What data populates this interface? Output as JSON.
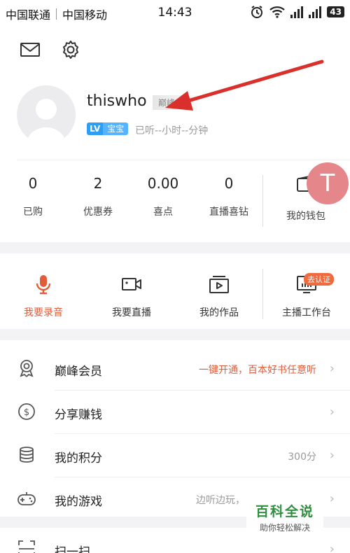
{
  "status_bar": {
    "carrier1": "中国联通",
    "carrier2": "中国移动",
    "time": "14:43",
    "battery": "43"
  },
  "profile": {
    "username": "thiswho",
    "vip_badge": "巅峰会员",
    "level_tag": "LV",
    "level_name": "宝宝",
    "listen_time": "已听--小时--分钟",
    "floating_initial": "T"
  },
  "stats": [
    {
      "value": "0",
      "label": "已购"
    },
    {
      "value": "2",
      "label": "优惠券"
    },
    {
      "value": "0.00",
      "label": "喜点"
    },
    {
      "value": "0",
      "label": "直播喜钻"
    }
  ],
  "wallet_label": "我的钱包",
  "actions": [
    {
      "label": "我要录音"
    },
    {
      "label": "我要直播"
    },
    {
      "label": "我的作品"
    },
    {
      "label": "主播工作台"
    }
  ],
  "cert_tag": "去认证",
  "menu": [
    {
      "title": "巅峰会员",
      "extra": "一键开通，百本好书任意听"
    },
    {
      "title": "分享赚钱",
      "extra": ""
    },
    {
      "title": "我的积分",
      "extra": "300分"
    },
    {
      "title": "我的游戏",
      "extra": "边听边玩，"
    }
  ],
  "menu_partial": "扫一扫",
  "watermark": {
    "line1": "百科全说",
    "line2": "助你轻松解决"
  },
  "colors": {
    "accent": "#e05d3a",
    "level_blue": "#2e9ef5",
    "arrow_red": "#d9302c"
  }
}
